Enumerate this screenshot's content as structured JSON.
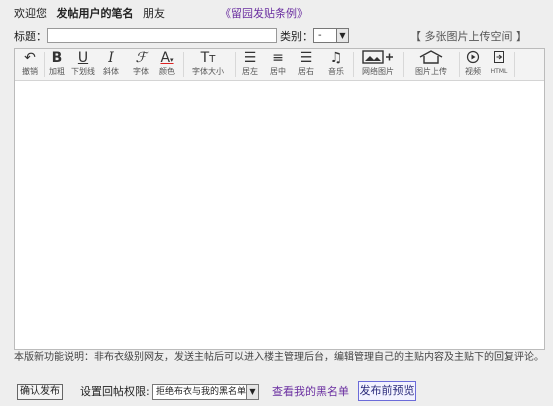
{
  "header": {
    "welcome": "欢迎您",
    "username": "发帖用户的笔名",
    "suffix": "朋友",
    "rules_link": "《留园发贴条例》"
  },
  "form": {
    "title_label": "标题：",
    "title_value": "",
    "category_label": "类别：",
    "category_value": "-",
    "multi_upload": "【 多张图片上传空间 】"
  },
  "toolbar": {
    "items": [
      {
        "icon": "undo-icon",
        "label": "撤销"
      },
      {
        "icon": "bold-icon",
        "label": "加粗"
      },
      {
        "icon": "underline-icon",
        "label": "下划线"
      },
      {
        "icon": "italic-icon",
        "label": "斜体"
      },
      {
        "icon": "font-icon",
        "label": "字体"
      },
      {
        "icon": "text-color-icon",
        "label": "颜色"
      },
      {
        "icon": "font-size-icon",
        "label": "字体大小"
      },
      {
        "icon": "align-left-icon",
        "label": "居左"
      },
      {
        "icon": "align-center-icon",
        "label": "居中"
      },
      {
        "icon": "align-right-icon",
        "label": "居右"
      },
      {
        "icon": "music-icon",
        "label": "音乐"
      },
      {
        "icon": "web-image-icon",
        "label": "网络图片"
      },
      {
        "icon": "image-upload-icon",
        "label": "图片上传"
      },
      {
        "icon": "video-icon",
        "label": "视频"
      },
      {
        "icon": "html-icon",
        "label": "HTML"
      }
    ]
  },
  "notice": "本版新功能说明：非布衣级别网友，发送主帖后可以进入楼主管理后台，编辑管理自己的主贴内容及主贴下的回复评论。",
  "footer": {
    "confirm_button": "确认发布",
    "permission_label": "设置回帖权限:",
    "permission_value": "拒绝布衣与我的黑名单",
    "blacklist_link": "查看我的黑名单",
    "preview_button": "发布前预览"
  }
}
